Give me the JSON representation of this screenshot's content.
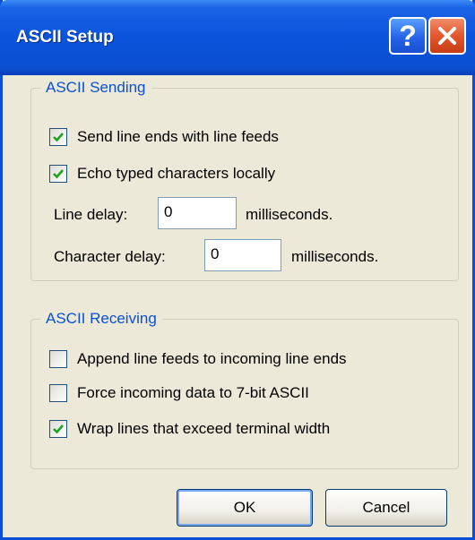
{
  "window": {
    "title": "ASCII Setup",
    "help_glyph": "?"
  },
  "sending": {
    "legend": "ASCII Sending",
    "options": [
      {
        "label": "Send line ends with line feeds",
        "checked": true
      },
      {
        "label": "Echo typed characters locally",
        "checked": true
      }
    ],
    "line_delay": {
      "label": "Line delay:",
      "value": "0",
      "unit": "milliseconds."
    },
    "char_delay": {
      "label": "Character delay:",
      "value": "0",
      "unit": "milliseconds."
    }
  },
  "receiving": {
    "legend": "ASCII Receiving",
    "options": [
      {
        "label": "Append line feeds to incoming line ends",
        "checked": false
      },
      {
        "label": "Force incoming data to 7-bit ASCII",
        "checked": false
      },
      {
        "label": "Wrap lines that exceed terminal width",
        "checked": true
      }
    ]
  },
  "buttons": {
    "ok": "OK",
    "cancel": "Cancel"
  },
  "colors": {
    "titlebar": "#0a54dc",
    "legend": "#0b4fd6",
    "check": "#21a121",
    "face": "#ece9d8"
  }
}
